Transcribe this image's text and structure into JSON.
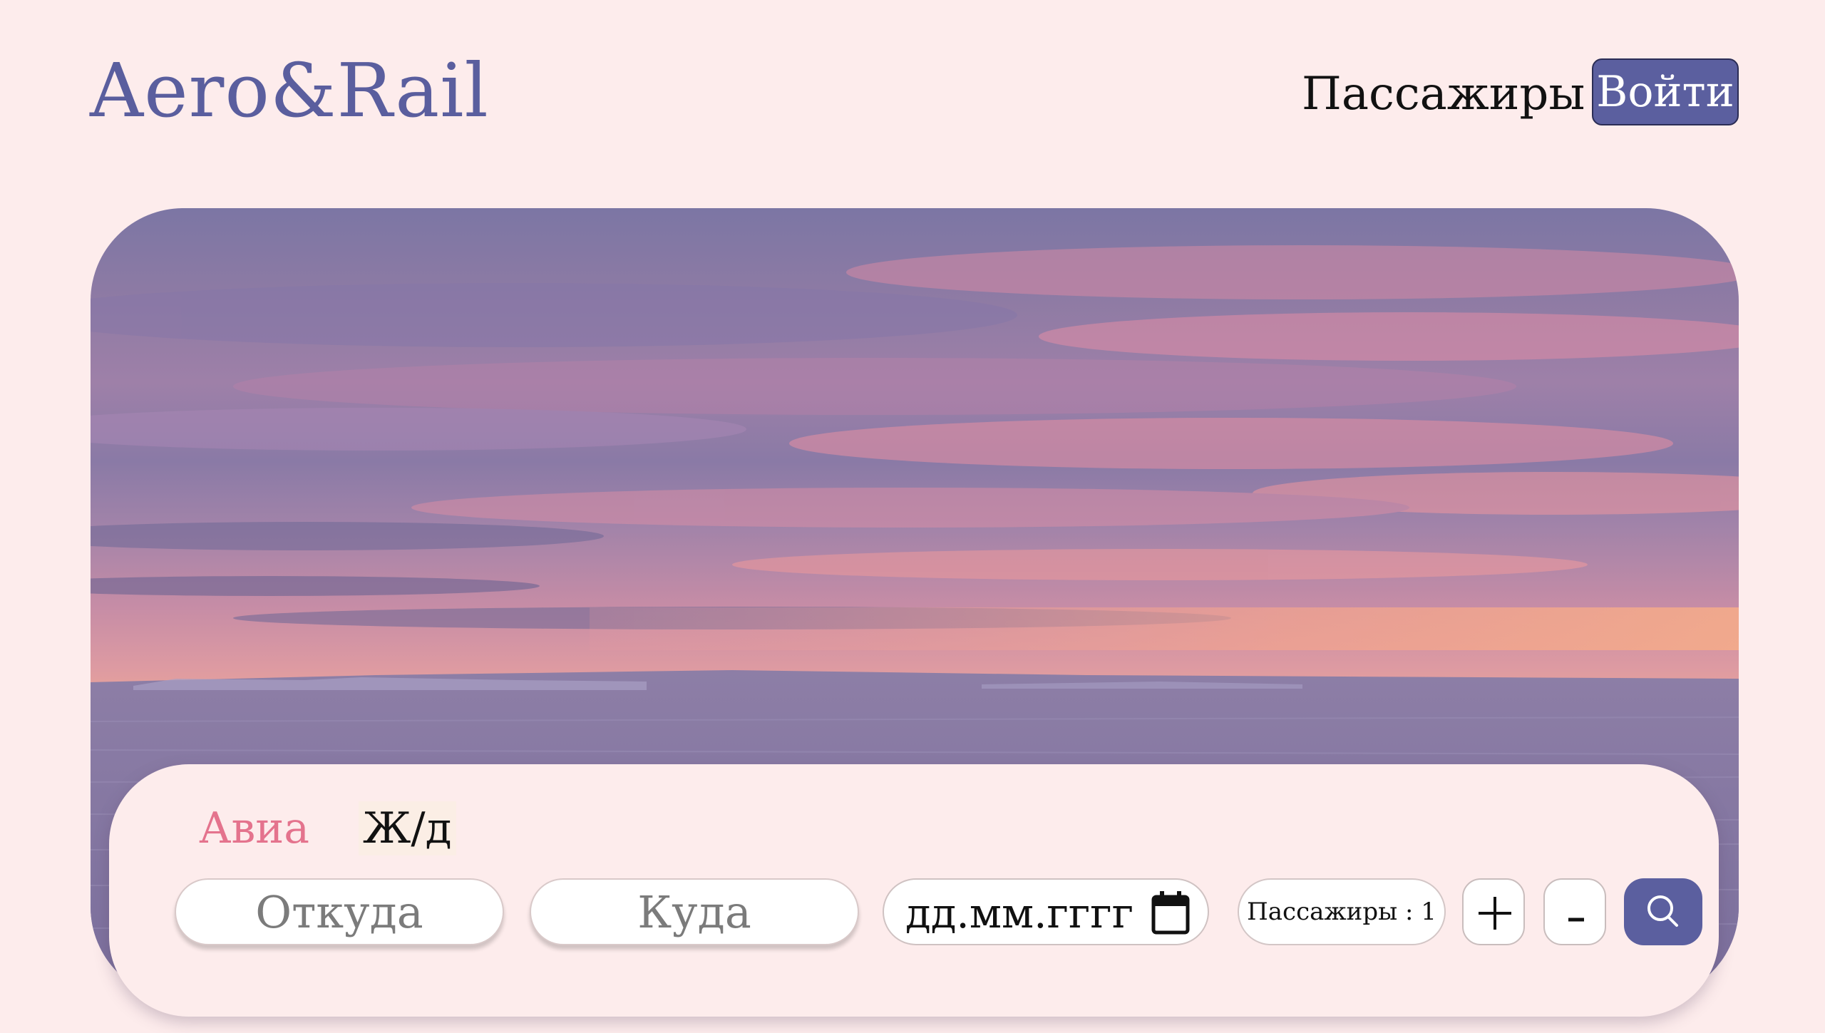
{
  "brand": {
    "logo": "Aero&Rail",
    "color": "#5a5e9e"
  },
  "nav": {
    "passengers_link": "Пассажиры",
    "login_button": "Войти"
  },
  "search": {
    "tabs": [
      {
        "label": "Авиа",
        "active": true
      },
      {
        "label": "Ж/д",
        "active": false
      }
    ],
    "from_placeholder": "Откуда",
    "to_placeholder": "Куда",
    "date_placeholder": "дд.мм.гггг",
    "passengers_label": "Пассажиры : 1",
    "passengers_count": 1,
    "plus_icon": "plus-icon",
    "minus_icon": "minus-icon",
    "search_icon": "search-icon"
  },
  "colors": {
    "background": "#fdecec",
    "accent": "#5b5f9f",
    "active_tab": "#e4738d"
  }
}
